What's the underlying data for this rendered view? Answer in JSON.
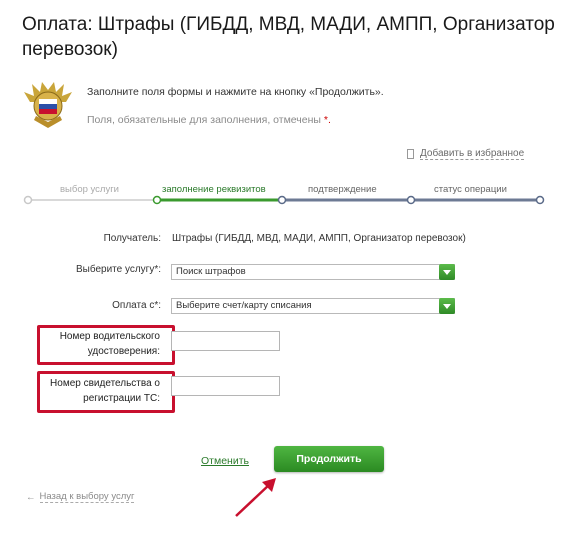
{
  "page": {
    "title": "Оплата: Штрафы (ГИБДД, МВД, МАДИ, АМПП, Организатор перевозок)"
  },
  "intro": {
    "instruction": "Заполните поля формы и нажмите на кнопку «Продолжить».",
    "required_note": "Поля, обязательные для заполнения, отмечены",
    "required_star": "*."
  },
  "favorites": {
    "label": "Добавить в избранное",
    "icon": "bookmark-icon"
  },
  "steps": [
    {
      "label": "выбор услуги",
      "state": "done"
    },
    {
      "label": "заполнение реквизитов",
      "state": "active"
    },
    {
      "label": "подтверждение",
      "state": "pending"
    },
    {
      "label": "статус операции",
      "state": "pending"
    }
  ],
  "form": {
    "recipient_label": "Получатель:",
    "recipient_value": "Штрафы (ГИБДД, МВД, МАДИ, АМПП, Организатор перевозок)",
    "service_label": "Выберите услугу*:",
    "service_value": "Поиск штрафов",
    "payment_label": "Оплата с*:",
    "payment_value": "Выберите счет/карту списания",
    "license_label_1": "Номер водительского",
    "license_label_2": "удостоверения:",
    "license_value": "",
    "registration_label_1": "Номер свидетельства о",
    "registration_label_2": "регистрации ТС:",
    "registration_value": ""
  },
  "actions": {
    "cancel": "Отменить",
    "continue": "Продолжить",
    "back": "Назад к выбору услуг"
  },
  "colors": {
    "accent_green": "#2b8a22",
    "highlight_red": "#c8102e"
  }
}
